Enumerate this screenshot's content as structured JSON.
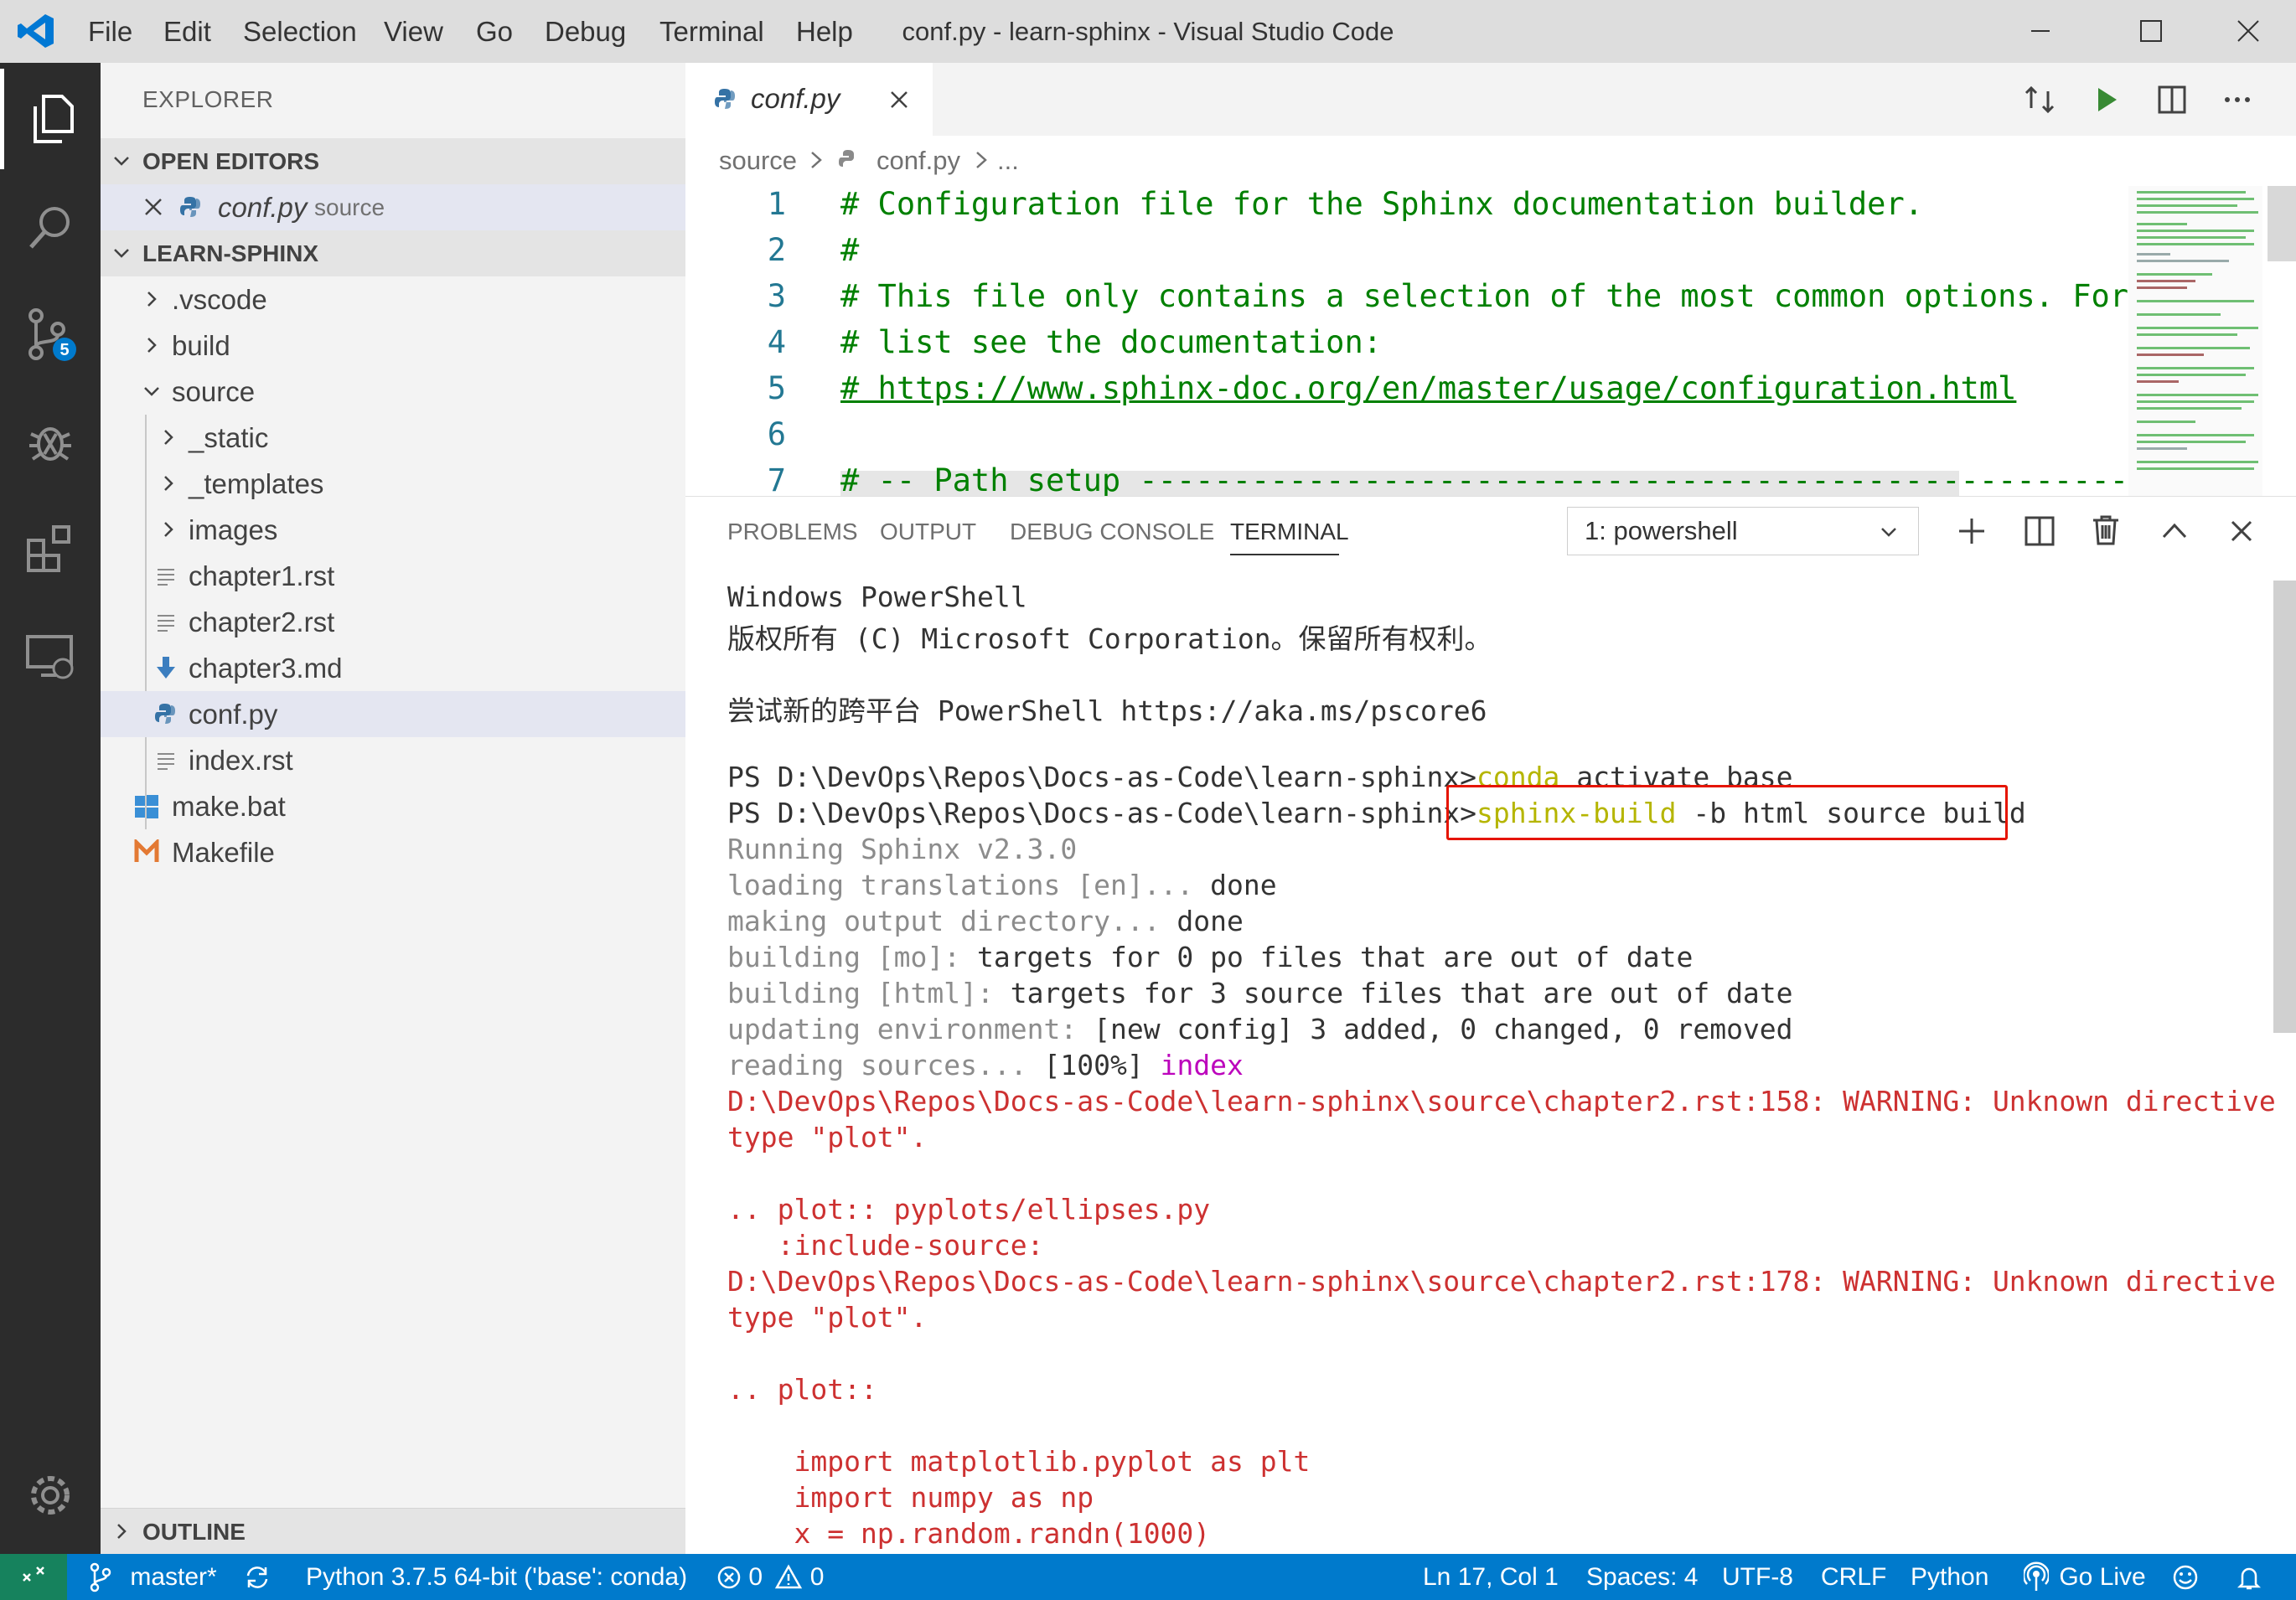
{
  "window": {
    "title": "conf.py - learn-sphinx - Visual Studio Code",
    "menu": [
      "File",
      "Edit",
      "Selection",
      "View",
      "Go",
      "Debug",
      "Terminal",
      "Help"
    ]
  },
  "activity": {
    "scm_badge": "5"
  },
  "sidebar": {
    "header": "EXPLORER",
    "open_editors_label": "OPEN EDITORS",
    "open_editor": {
      "name": "conf.py",
      "dir": "source"
    },
    "project_label": "LEARN-SPHINX",
    "tree": [
      {
        "label": ".vscode",
        "type": "folder"
      },
      {
        "label": "build",
        "type": "folder"
      },
      {
        "label": "source",
        "type": "folder-open"
      },
      {
        "label": "_static",
        "type": "folder"
      },
      {
        "label": "_templates",
        "type": "folder"
      },
      {
        "label": "images",
        "type": "folder"
      },
      {
        "label": "chapter1.rst",
        "type": "file"
      },
      {
        "label": "chapter2.rst",
        "type": "file"
      },
      {
        "label": "chapter3.md",
        "type": "md"
      },
      {
        "label": "conf.py",
        "type": "py"
      },
      {
        "label": "index.rst",
        "type": "file"
      },
      {
        "label": "make.bat",
        "type": "bat"
      },
      {
        "label": "Makefile",
        "type": "makefile"
      }
    ],
    "outline_label": "OUTLINE"
  },
  "editor": {
    "tab_label": "conf.py",
    "breadcrumb": [
      "source",
      "conf.py",
      "..."
    ],
    "lines": [
      {
        "n": "1",
        "text": "# Configuration file for the Sphinx documentation builder."
      },
      {
        "n": "2",
        "text": "#"
      },
      {
        "n": "3",
        "text": "# This file only contains a selection of the most common options. For"
      },
      {
        "n": "4",
        "text": "# list see the documentation:"
      },
      {
        "n": "5",
        "text": "# https://www.sphinx-doc.org/en/master/usage/configuration.html"
      },
      {
        "n": "6",
        "text": ""
      },
      {
        "n": "7",
        "text": "# -- Path setup --------------------------------------------------------"
      }
    ]
  },
  "panel": {
    "tabs": [
      "PROBLEMS",
      "OUTPUT",
      "DEBUG CONSOLE",
      "TERMINAL"
    ],
    "terminal_select": "1: powershell",
    "terminal": {
      "l1": "Windows PowerShell",
      "l2": "版权所有 (C) Microsoft Corporation。保留所有权利。",
      "l3": "尝试新的跨平台 PowerShell https://aka.ms/pscore6",
      "prompt": "PS D:\\DevOps\\Repos\\Docs-as-Code\\learn-sphinx>",
      "cmd1_a": "conda",
      "cmd1_b": " activate base",
      "cmd2_a": "sphinx-build",
      "cmd2_b": " -b html source build",
      "run": "Running Sphinx v2.3.0",
      "t1a": "loading translations [en]...",
      "t1b": " done",
      "t2a": "making output directory...",
      "t2b": " done",
      "t3a": "building [mo]:",
      "t3b": " targets for 0 po files that are out of date",
      "t4a": "building [html]:",
      "t4b": " targets for 3 source files that are out of date",
      "t5a": "updating environment:",
      "t5b": " [new config] 3 added, 0 changed, 0 removed",
      "t6a": "reading sources...",
      "t6b": " [100%] ",
      "t6c": "index",
      "w1": "D:\\DevOps\\Repos\\Docs-as-Code\\learn-sphinx\\source\\chapter2.rst:158: WARNING: Unknown directive",
      "w1b": "type \"plot\".",
      "p1": ".. plot:: pyplots/ellipses.py",
      "p2": "   :include-source:",
      "w2": "D:\\DevOps\\Repos\\Docs-as-Code\\learn-sphinx\\source\\chapter2.rst:178: WARNING: Unknown directive",
      "w2b": "type \"plot\".",
      "p3": ".. plot::",
      "c1": "    import matplotlib.pyplot as plt",
      "c2": "    import numpy as np",
      "c3": "    x = np.random.randn(1000)"
    }
  },
  "status": {
    "branch": "master*",
    "python": "Python 3.7.5 64-bit ('base': conda)",
    "errors": "0",
    "warnings": "0",
    "position": "Ln 17, Col 1",
    "spaces": "Spaces: 4",
    "encoding": "UTF-8",
    "eol": "CRLF",
    "language": "Python",
    "golive": "Go Live"
  },
  "colors": {
    "accent": "#007acc",
    "activity_bar": "#2c2c2c",
    "comment_green": "#008000",
    "terminal_red": "#cd3131",
    "highlight_box": "#e51400"
  }
}
